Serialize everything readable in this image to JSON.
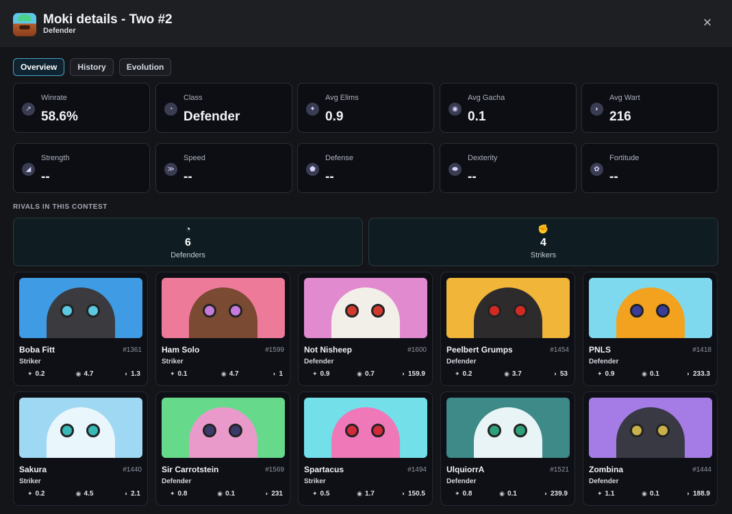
{
  "header": {
    "title": "Moki details - Two #2",
    "subtitle": "Defender",
    "close_icon": "×"
  },
  "tabs": [
    {
      "label": "Overview",
      "active": true
    },
    {
      "label": "History",
      "active": false
    },
    {
      "label": "Evolution",
      "active": false
    }
  ],
  "stats_row1": [
    {
      "label": "Winrate",
      "value": "58.6%",
      "icon": "chart-icon"
    },
    {
      "label": "Class",
      "value": "Defender",
      "icon": "clock-icon"
    },
    {
      "label": "Avg Elims",
      "value": "0.9",
      "icon": "elims-icon"
    },
    {
      "label": "Avg Gacha",
      "value": "0.1",
      "icon": "gacha-icon"
    },
    {
      "label": "Avg Wart",
      "value": "216",
      "icon": "wart-icon"
    }
  ],
  "stats_row2": [
    {
      "label": "Strength",
      "value": "--",
      "icon": "strength-icon"
    },
    {
      "label": "Speed",
      "value": "--",
      "icon": "speed-icon"
    },
    {
      "label": "Defense",
      "value": "--",
      "icon": "defense-icon"
    },
    {
      "label": "Dexterity",
      "value": "--",
      "icon": "dexterity-icon"
    },
    {
      "label": "Fortitude",
      "value": "--",
      "icon": "fortitude-icon"
    }
  ],
  "rivals": {
    "section_label": "RIVALS IN THIS CONTEST",
    "summary": [
      {
        "count": "6",
        "caption": "Defenders",
        "icon": "defender-icon"
      },
      {
        "count": "4",
        "caption": "Strikers",
        "icon": "striker-icon"
      }
    ],
    "cards": [
      {
        "name": "Boba Fitt",
        "number": "#1361",
        "class": "Striker",
        "elims": "0.2",
        "gacha": "4.7",
        "wart": "1.3",
        "bg": "#3f9be3",
        "body": "#3a3a3f",
        "eye": "#5cc9e0"
      },
      {
        "name": "Ham Solo",
        "number": "#1599",
        "class": "Striker",
        "elims": "0.1",
        "gacha": "4.7",
        "wart": "1",
        "bg": "#ee7a9a",
        "body": "#7a4a32",
        "eye": "#c67ad9"
      },
      {
        "name": "Not Nisheep",
        "number": "#1600",
        "class": "Defender",
        "elims": "0.9",
        "gacha": "0.7",
        "wart": "159.9",
        "bg": "#e28ad0",
        "body": "#f2efe9",
        "eye": "#d23a2e"
      },
      {
        "name": "Peelbert Grumps",
        "number": "#1454",
        "class": "Defender",
        "elims": "0.2",
        "gacha": "3.7",
        "wart": "53",
        "bg": "#f1b53a",
        "body": "#2e2b2c",
        "eye": "#d02a22"
      },
      {
        "name": "PNLS",
        "number": "#1418",
        "class": "Defender",
        "elims": "0.9",
        "gacha": "0.1",
        "wart": "233.3",
        "bg": "#7fd9ee",
        "body": "#f2a21f",
        "eye": "#3a3c9a"
      },
      {
        "name": "Sakura",
        "number": "#1440",
        "class": "Striker",
        "elims": "0.2",
        "gacha": "4.5",
        "wart": "2.1",
        "bg": "#9fd8f2",
        "body": "#e9f6fc",
        "eye": "#38b8b6"
      },
      {
        "name": "Sir Carrotstein",
        "number": "#1569",
        "class": "Defender",
        "elims": "0.8",
        "gacha": "0.1",
        "wart": "231",
        "bg": "#66d98a",
        "body": "#e99aca",
        "eye": "#3b3a6a"
      },
      {
        "name": "Spartacus",
        "number": "#1494",
        "class": "Striker",
        "elims": "0.5",
        "gacha": "1.7",
        "wart": "150.5",
        "bg": "#72dfe9",
        "body": "#ef78b8",
        "eye": "#d12a3a"
      },
      {
        "name": "UlquiorrA",
        "number": "#1521",
        "class": "Defender",
        "elims": "0.8",
        "gacha": "0.1",
        "wart": "239.9",
        "bg": "#3d8a88",
        "body": "#e8f4f6",
        "eye": "#2fa07a"
      },
      {
        "name": "Zombina",
        "number": "#1444",
        "class": "Defender",
        "elims": "1.1",
        "gacha": "0.1",
        "wart": "188.9",
        "bg": "#a57ce6",
        "body": "#393943",
        "eye": "#c9b04a"
      }
    ]
  }
}
